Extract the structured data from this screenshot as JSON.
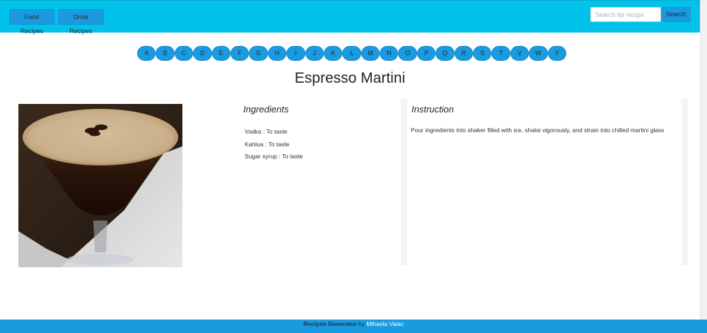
{
  "nav": {
    "food_label": "Food Recipes",
    "drink_label": "Drink Recipes"
  },
  "search": {
    "placeholder": "Search for recipe",
    "value": "",
    "button_label": "Search"
  },
  "letters": [
    "A",
    "B",
    "C",
    "D",
    "E",
    "F",
    "G",
    "H",
    "I",
    "J",
    "K",
    "L",
    "M",
    "N",
    "O",
    "P",
    "Q",
    "R",
    "S",
    "T",
    "V",
    "W",
    "Y"
  ],
  "recipe": {
    "title": "Espresso Martini",
    "ingredients_heading": "Ingredients",
    "ingredients": [
      "Vodka : To taste",
      "Kahlua : To taste",
      "Sugar syrup : To taste"
    ],
    "instruction_heading": "Instruction",
    "instruction": "Pour ingredients into shaker filled with ice, shake vigorously, and strain into chilled martini glass"
  },
  "footer": {
    "app_name": "Recipes Generator",
    "by": "by",
    "author": "Mihaela Valac"
  },
  "colors": {
    "header": "#01c3ea",
    "button": "#1a9be0",
    "footer": "#1a9be0"
  }
}
